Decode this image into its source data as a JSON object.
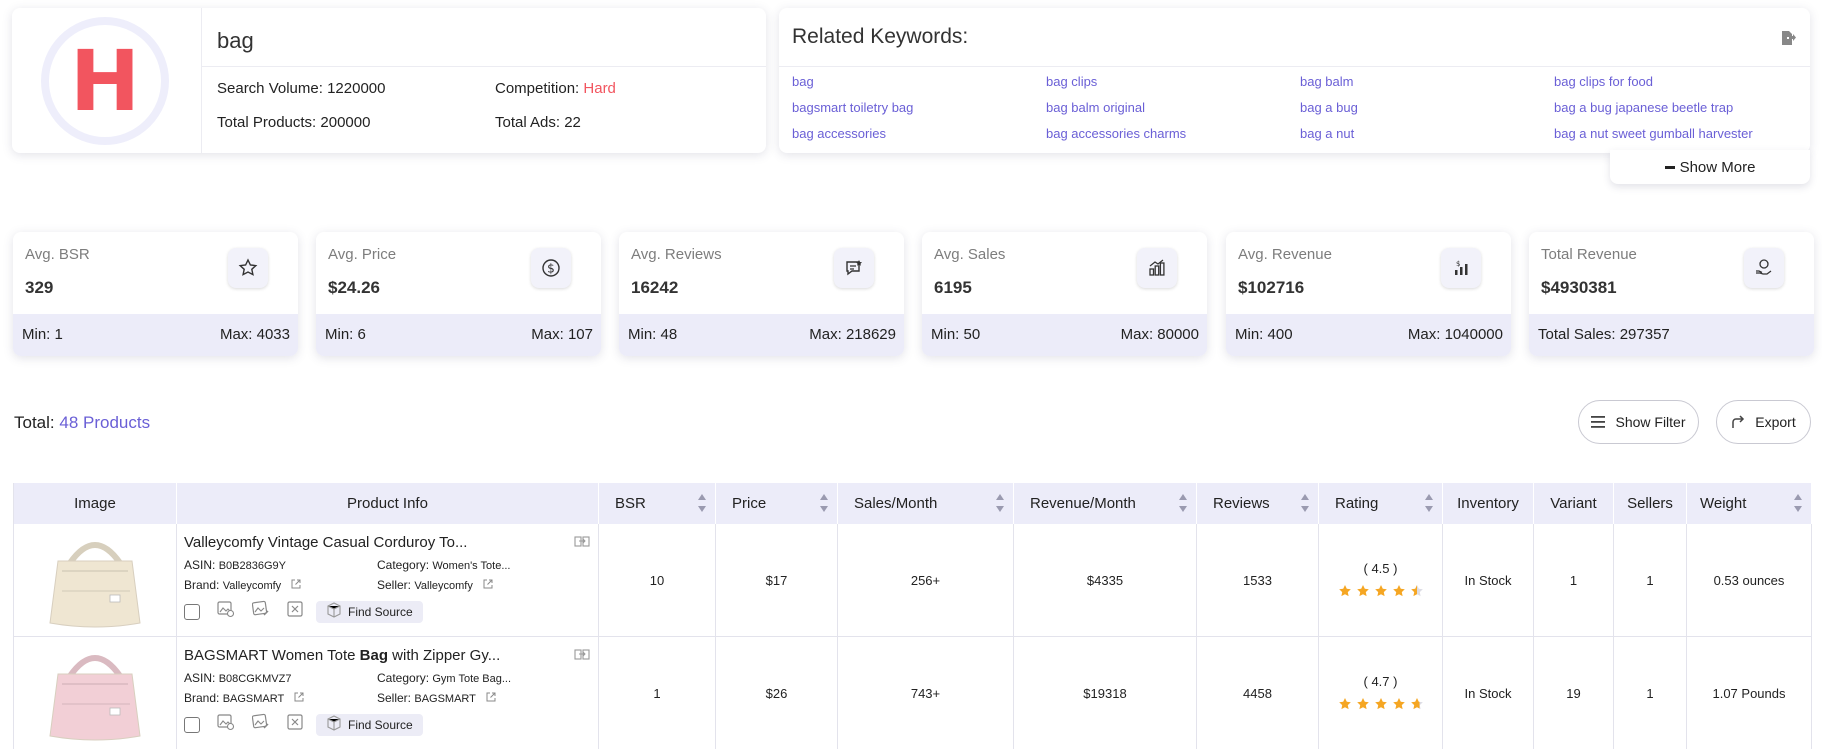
{
  "keyword": {
    "logo_letter": "H",
    "title": "bag",
    "search_volume_label": "Search Volume:",
    "search_volume": "1220000",
    "competition_label": "Competition:",
    "competition": "Hard",
    "total_products_label": "Total Products:",
    "total_products": "200000",
    "total_ads_label": "Total Ads:",
    "total_ads": "22"
  },
  "related": {
    "title": "Related Keywords:",
    "keywords": [
      "bag",
      "bag clips",
      "bag balm",
      "bag clips for food",
      "bagsmart toiletry bag",
      "bag balm original",
      "bag a bug",
      "bag a bug japanese beetle trap",
      "bag accessories",
      "bag accessories charms",
      "bag a nut",
      "bag a nut sweet gumball harvester"
    ],
    "show_more": "Show More"
  },
  "stats": [
    {
      "label": "Avg. BSR",
      "value": "329",
      "icon": "star-icon",
      "min": "Min: 1",
      "max": "Max: 4033"
    },
    {
      "label": "Avg. Price",
      "value": "$24.26",
      "icon": "dollar-icon",
      "min": "Min: 6",
      "max": "Max: 107"
    },
    {
      "label": "Avg. Reviews",
      "value": "16242",
      "icon": "review-icon",
      "min": "Min: 48",
      "max": "Max: 218629"
    },
    {
      "label": "Avg. Sales",
      "value": "6195",
      "icon": "sales-chart-icon",
      "min": "Min: 50",
      "max": "Max: 80000"
    },
    {
      "label": "Avg. Revenue",
      "value": "$102716",
      "icon": "revenue-chart-icon",
      "min": "Min: 400",
      "max": "Max: 1040000"
    },
    {
      "label": "Total Revenue",
      "value": "$4930381",
      "icon": "money-hand-icon",
      "min": "Total Sales: 297357",
      "max": ""
    }
  ],
  "toolbar": {
    "total_label": "Total:",
    "total_count": "48 Products",
    "show_filter": "Show Filter",
    "export": "Export"
  },
  "table": {
    "headers": [
      "Image",
      "Product Info",
      "BSR",
      "Price",
      "Sales/Month",
      "Revenue/Month",
      "Reviews",
      "Rating",
      "Inventory",
      "Variant",
      "Sellers",
      "Weight"
    ],
    "rows": [
      {
        "name": "Valleycomfy Vintage Casual Corduroy To...",
        "asin_label": "ASIN:",
        "asin": "B0B2836G9Y",
        "category_label": "Category:",
        "category": "Women's Tote...",
        "brand_label": "Brand:",
        "brand": "Valleycomfy",
        "seller_label": "Seller:",
        "seller": "Valleycomfy",
        "find_source": "Find Source",
        "bsr": "10",
        "price": "$17",
        "sales": "256+",
        "revenue": "$4335",
        "reviews": "1533",
        "rating_text": "( 4.5 )",
        "rating": 4.5,
        "inventory": "In Stock",
        "variant": "1",
        "sellers": "1",
        "weight": "0.53 ounces",
        "image_color": "#efe6d2"
      },
      {
        "name_pre": "BAGSMART Women Tote ",
        "name_bold": "Bag",
        "name_post": " with Zipper Gy...",
        "asin_label": "ASIN:",
        "asin": "B08CGKMVZ7",
        "category_label": "Category:",
        "category": "Gym Tote Bag...",
        "brand_label": "Brand:",
        "brand": "BAGSMART",
        "seller_label": "Seller:",
        "seller": "BAGSMART",
        "find_source": "Find Source",
        "bsr": "1",
        "price": "$26",
        "sales": "743+",
        "revenue": "$19318",
        "reviews": "4458",
        "rating_text": "( 4.7 )",
        "rating": 4.7,
        "inventory": "In Stock",
        "variant": "19",
        "sellers": "1",
        "weight": "1.07 Pounds",
        "image_color": "#f2cfd6"
      }
    ]
  }
}
